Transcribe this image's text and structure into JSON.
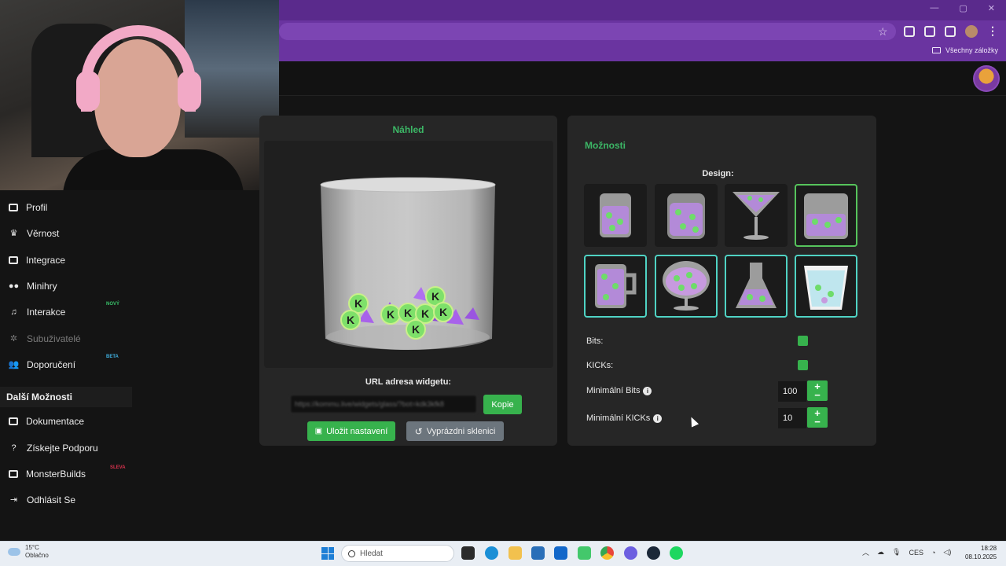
{
  "browser": {
    "bookmarks_label": "Všechny záložky"
  },
  "sidebar": {
    "items": [
      {
        "label": "Profil"
      },
      {
        "label": "Věrnost"
      },
      {
        "label": "Integrace"
      },
      {
        "label": "Minihry"
      },
      {
        "label": "Interakce",
        "badge": "NOVÝ"
      },
      {
        "label": "Subuživatelé"
      },
      {
        "label": "Doporučení",
        "badge": "BETA"
      }
    ],
    "section_title": "Další Možnosti",
    "extra_items": [
      {
        "label": "Dokumentace"
      },
      {
        "label": "Získejte Podporu"
      },
      {
        "label": "MonsterBuilds",
        "badge": "SLEVA"
      },
      {
        "label": "Odhlásit Se"
      }
    ]
  },
  "preview": {
    "title": "Náhled",
    "url_label": "URL adresa widgetu:",
    "url_value": "https://kommu.live/widgets/glass/?bot=kdk3kfk8",
    "copy_label": "Kopie",
    "save_label": "Uložit nastavení",
    "empty_label": "Vyprázdni sklenici"
  },
  "options": {
    "title": "Možnosti",
    "design_label": "Design:",
    "designs": [
      {
        "name": "small-jar",
        "selected": false
      },
      {
        "name": "cylinder-jar",
        "selected": false
      },
      {
        "name": "martini-glass",
        "selected": false
      },
      {
        "name": "wide-glass",
        "selected": true
      },
      {
        "name": "beer-mug",
        "selected": false
      },
      {
        "name": "brandy-snifter",
        "selected": false
      },
      {
        "name": "erlenmeyer-flask",
        "selected": false
      },
      {
        "name": "plastic-cup",
        "selected": false
      }
    ],
    "bits_label": "Bits:",
    "bits_checked": true,
    "kicks_label": "KICKs:",
    "kicks_checked": true,
    "min_bits_label": "Minimální Bits",
    "min_bits_value": "100",
    "min_kicks_label": "Minimální KICKs",
    "min_kicks_value": "10"
  },
  "taskbar": {
    "temperature": "15°C",
    "weather_desc": "Oblačno",
    "search_placeholder": "Hledat",
    "language": "CES",
    "time": "18:28",
    "date": "08.10.2025"
  },
  "colors": {
    "accent_green": "#37b24d",
    "title_green": "#3cb766",
    "browser_purple": "#6a34a0",
    "tile_cyan": "#4fd3c4"
  }
}
